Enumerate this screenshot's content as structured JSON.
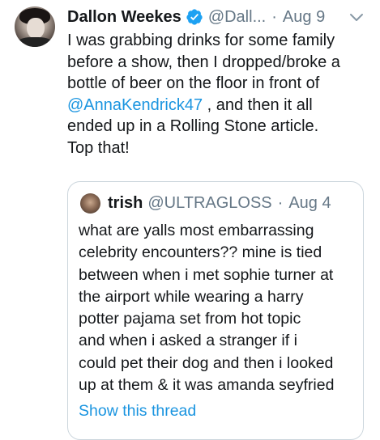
{
  "tweet": {
    "author_name": "Dallon Weekes",
    "author_handle": "@Dall...",
    "separator": "·",
    "date": "Aug 9",
    "verified_icon": "verified-badge-icon",
    "menu_icon": "chevron-down-icon",
    "lines": [
      "I was grabbing drinks for some family",
      "before a show, then I dropped/broke a",
      "bottle of beer on the floor in front of"
    ],
    "mention": "@AnnaKendrick47",
    "after_mention": " , and then it all",
    "lines_end": [
      "ended up in a Rolling Stone article.",
      "Top that!"
    ]
  },
  "quoted": {
    "author_name": "trish",
    "author_handle": "@ULTRAGLOSS",
    "separator": "·",
    "date": "Aug 4",
    "lines": [
      "what are yalls most embarrassing",
      "celebrity encounters?? mine is tied",
      "between when i met sophie turner at",
      "the airport while wearing a harry",
      "potter pajama set from hot topic",
      "and when i asked a stranger if i",
      "could pet their dog and then i looked",
      "up at them & it was amanda seyfried"
    ],
    "show_thread": "Show this thread"
  },
  "colors": {
    "text": "#14171a",
    "secondary": "#657786",
    "link": "#1b95e0",
    "verified": "#1da1f2",
    "border": "#ccd6dd"
  }
}
